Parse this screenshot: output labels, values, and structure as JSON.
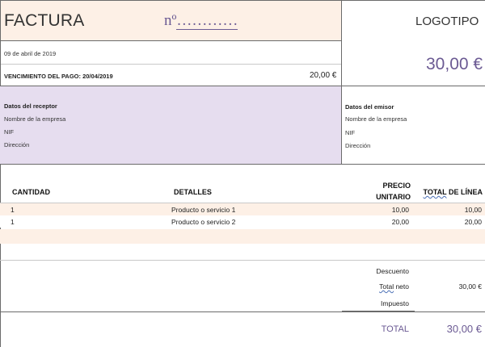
{
  "header": {
    "title": "FACTURA",
    "number_label": "nº",
    "number_placeholder": "…………",
    "logo": "LOGOTIPO"
  },
  "info": {
    "date": "09 de abril de 2019",
    "due_label": "VENCIMIENTO DEL PAGO: 20/04/2019",
    "due_amount": "20,00 €",
    "big_amount": "30,00 €"
  },
  "receptor": {
    "title": "Datos del receptor",
    "company": "Nombre de la empresa",
    "nif": "NIF",
    "address": "Dirección"
  },
  "emisor": {
    "title": "Datos del emisor",
    "company": "Nombre de la empresa",
    "nif": "NIF",
    "address": "Dirección"
  },
  "table": {
    "col_qty": "CANTIDAD",
    "col_details": "DETALLES",
    "col_price_1": "PRECIO",
    "col_price_2": "UNITARIO",
    "col_total_a": "TOTAL",
    "col_total_b": " DE LÍNEA",
    "rows": [
      {
        "qty": "1",
        "details": "Producto o servicio 1",
        "price": "10,00",
        "total": "10,00"
      },
      {
        "qty": "1",
        "details": "Producto o servicio 2",
        "price": "20,00",
        "total": "20,00"
      }
    ]
  },
  "summary": {
    "discount_label": "Descuento",
    "net_label_a": "Total",
    "net_label_b": " neto",
    "net_value": "30,00 €",
    "tax_label": "Impuesto",
    "total_label": "TOTAL",
    "total_value": "30,00 €"
  },
  "colors": {
    "peach": "#fdf0e6",
    "lavender": "#e6ddef",
    "accent": "#6b5a93"
  }
}
